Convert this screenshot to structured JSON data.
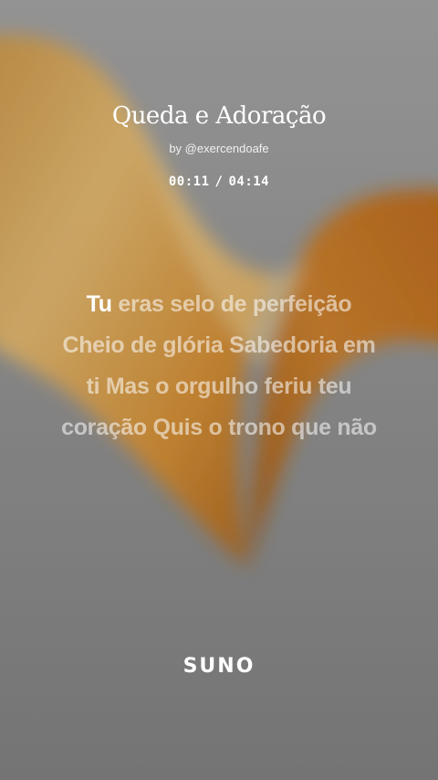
{
  "song": {
    "title": "Queda e Adoração",
    "byline": "by @exercendoafe",
    "elapsed": "00:11",
    "separator": "/",
    "duration": "04:14"
  },
  "lyrics": {
    "active_word": "Tu",
    "line1_rest": " eras selo de perfeição",
    "line2": "Cheio de glória Sabedoria em",
    "line3": "ti Mas o orgulho feriu teu",
    "line4": "coração Quis o trono que não"
  },
  "brand": {
    "logo_text": "SUNO"
  },
  "colors": {
    "background": "#8a8a8a",
    "ribbon": "#d79a3c",
    "text": "#ffffff"
  }
}
